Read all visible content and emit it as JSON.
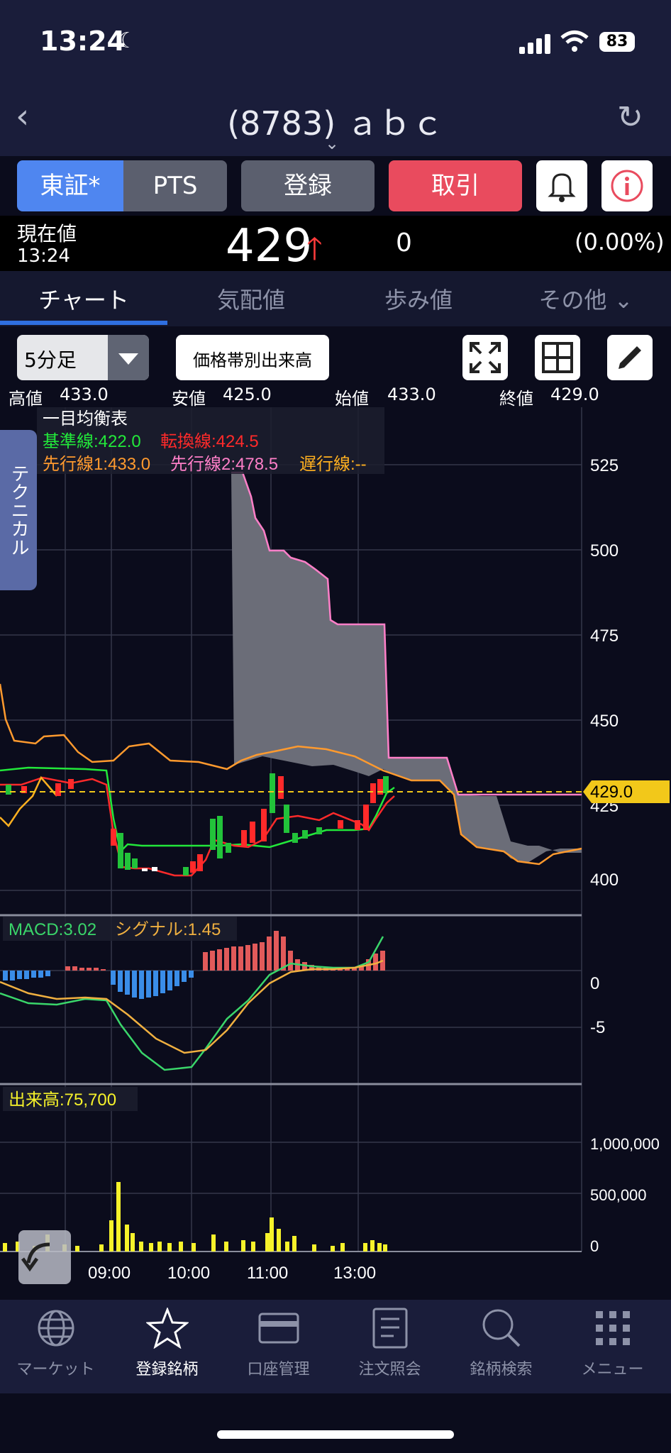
{
  "status": {
    "time": "13:24",
    "battery": "83"
  },
  "header": {
    "title": "(8783) ａｂｃ"
  },
  "toolbar_buttons": {
    "tse": "東証*",
    "pts": "PTS",
    "register": "登録",
    "trade": "取引"
  },
  "quote": {
    "label": "現在値",
    "time": "13:24",
    "price": "429",
    "change": "0",
    "change_pct": "(0.00%)"
  },
  "tabs": [
    {
      "label": "チャート",
      "active": true
    },
    {
      "label": "気配値",
      "active": false
    },
    {
      "label": "歩み値",
      "active": false
    },
    {
      "label": "その他 ⌄",
      "active": false
    }
  ],
  "chart_controls": {
    "interval": "5分足",
    "volume_profile": "価格帯別出来高"
  },
  "ohlc": {
    "high_label": "高値",
    "high": "433.0",
    "low_label": "安値",
    "low": "425.0",
    "open_label": "始値",
    "open": "433.0",
    "close_label": "終値",
    "close": "429.0"
  },
  "ichimoku_legend": {
    "title": "一目均衡表",
    "kijun": "基準線:422.0",
    "tenkan": "転換線:424.5",
    "senkou1": "先行線1:433.0",
    "senkou2": "先行線2:478.5",
    "chikou": "遅行線:--"
  },
  "macd_legend": {
    "macd": "MACD:3.02",
    "signal": "シグナル:1.45"
  },
  "volume_legend": {
    "volume": "出来高:75,700"
  },
  "technical_tab": "テクニカル",
  "current_price_tag": "429.0",
  "chart_data": {
    "type": "line",
    "x": [
      "09:00",
      "10:00",
      "11:00",
      "13:00"
    ],
    "price_axis": {
      "ticks": [
        "525",
        "500",
        "475",
        "450",
        "425",
        "400"
      ]
    },
    "macd_axis": {
      "ticks": [
        "0",
        "-5"
      ]
    },
    "volume_axis": {
      "ticks": [
        "1,000,000",
        "500,000",
        "0"
      ]
    },
    "series": [
      {
        "name": "基準線",
        "color": "#22e83a"
      },
      {
        "name": "転換線",
        "color": "#ff2a2a"
      },
      {
        "name": "先行線1",
        "color": "#ff9a2e"
      },
      {
        "name": "先行線2",
        "color": "#ff7fc8"
      },
      {
        "name": "MACD",
        "color": "#3ad66a"
      },
      {
        "name": "シグナル",
        "color": "#f0b040"
      },
      {
        "name": "出来高",
        "color": "#f6f22a"
      }
    ]
  },
  "bottom_nav": [
    {
      "label": "マーケット",
      "icon": "globe-icon",
      "active": false
    },
    {
      "label": "登録銘柄",
      "icon": "star-icon",
      "active": true
    },
    {
      "label": "口座管理",
      "icon": "card-icon",
      "active": false
    },
    {
      "label": "注文照会",
      "icon": "document-icon",
      "active": false
    },
    {
      "label": "銘柄検索",
      "icon": "search-icon",
      "active": false
    },
    {
      "label": "メニュー",
      "icon": "menu-grid-icon",
      "active": false
    }
  ]
}
